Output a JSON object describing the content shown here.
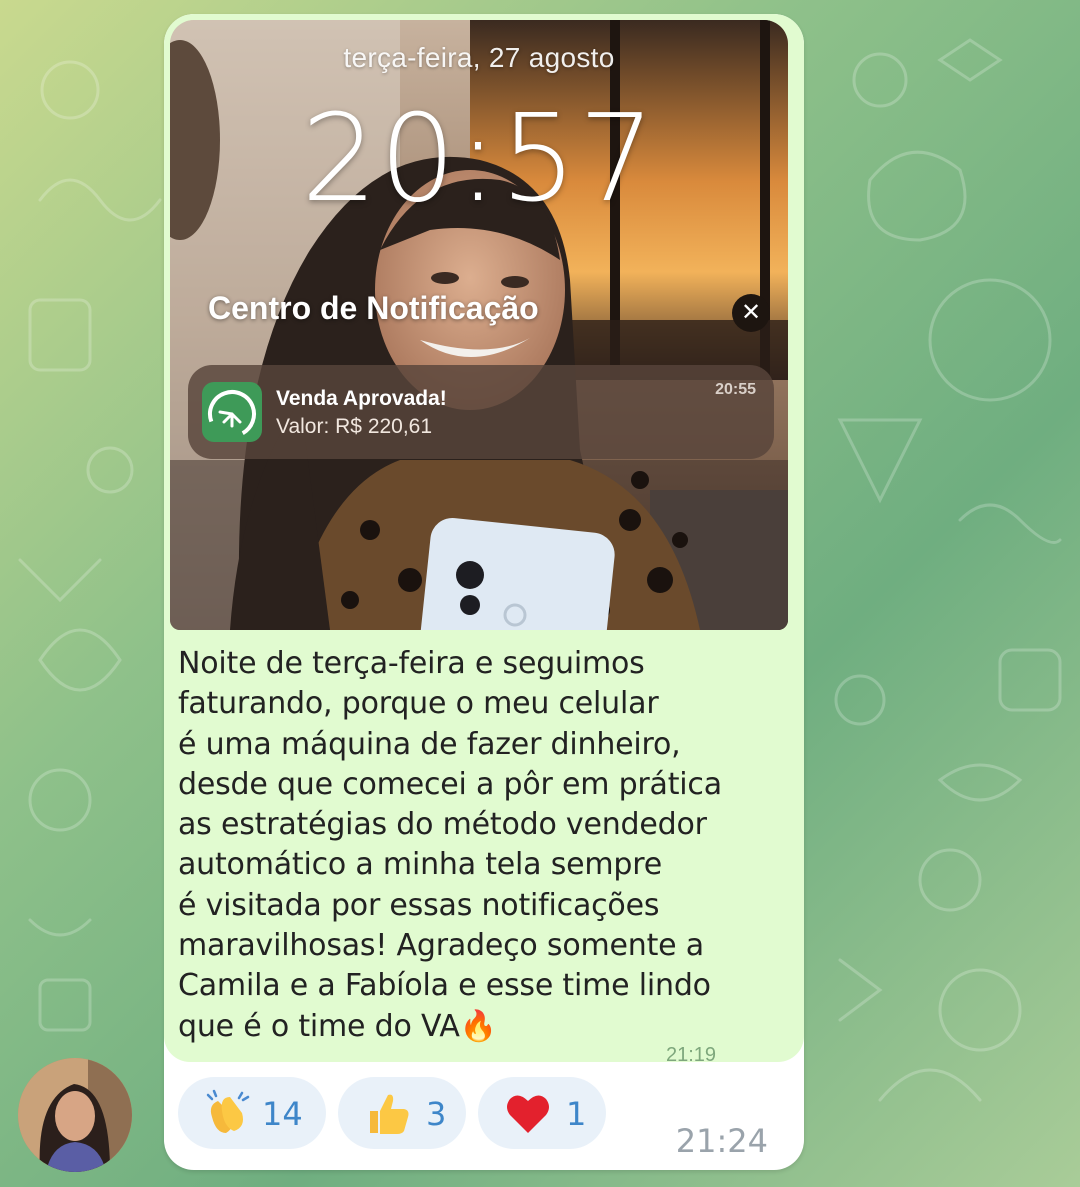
{
  "colors": {
    "bubble_bg": "#ffffff",
    "message_bg": "#e1fbd0",
    "reaction_bg": "#e9f1f9",
    "reaction_count": "#3e86c9",
    "timestamp": "#9aa3ab",
    "app_icon": "#3e9a58"
  },
  "screenshot": {
    "date": "terça-feira, 27 agosto",
    "clock": "20:57",
    "notification_center_title": "Centro de Notificação",
    "close_icon": "close-icon",
    "notification": {
      "app_icon": "lime-slice-icon",
      "title": "Venda Aprovada!",
      "body": "Valor: R$ 220,61",
      "time": "20:55"
    }
  },
  "message": {
    "lines": [
      "Noite de terça-feira e seguimos",
      "faturando, porque o meu celular",
      "é uma máquina de fazer dinheiro,",
      "desde que comecei a pôr em prática",
      "as estratégias do método vendedor",
      "automático a minha tela sempre",
      "é visitada por essas notificações",
      "maravilhosas! Agradeço somente a",
      "Camila e a Fabíola e esse time lindo",
      "que é o time do VA"
    ],
    "emoji": "🔥",
    "inner_timestamp": "21:19"
  },
  "reactions": [
    {
      "icon": "clapping-hands-icon",
      "count": "14"
    },
    {
      "icon": "thumbs-up-icon",
      "count": "3"
    },
    {
      "icon": "red-heart-icon",
      "count": "1"
    }
  ],
  "time": "21:24",
  "avatar": "user-avatar"
}
